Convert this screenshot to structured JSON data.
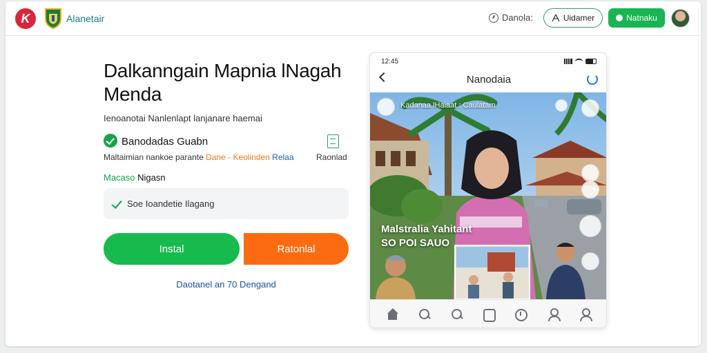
{
  "header": {
    "brand": "Alanetair",
    "language_label": "Danola:",
    "outline_button": "Uidamer",
    "green_button": "Natnaku"
  },
  "main": {
    "headline": "Dalkanngain Mapnia lNagah Menda",
    "subtitle": "Ienoanotai  Nanlenlapt lanjanare haemai",
    "feature": {
      "title": "Banodadas Guabn",
      "desc_prefix": "Maltaimian  nankoe parante ",
      "desc_orange": "Dane - Keolinden",
      "desc_blue": " Relaa",
      "side_label": "Raonlad"
    },
    "status_label_green": "Macaso",
    "status_label_rest": " Nigasn",
    "status_text": "Soe Ioandetie Ilagang",
    "install_button": "Instal",
    "orange_button": "Ratonlal",
    "link_text": "Daotanel an  70 Dengand"
  },
  "phone": {
    "time": "12:45",
    "title": "Nanodaia",
    "hero_top_text": "Kadanaa lHaiaat : Caulatam",
    "hero_caption_1": "Malstralia Yahitant",
    "hero_caption_2": "SO POI SAUO"
  },
  "colors": {
    "accent_green": "#17bb4d",
    "accent_orange": "#fb6c12",
    "link_blue": "#1a4fa0",
    "brand_red": "#d7263d"
  },
  "icons": [
    "home-icon",
    "search-icon",
    "search-icon",
    "box-icon",
    "clock-icon",
    "user-icon",
    "user-icon"
  ]
}
